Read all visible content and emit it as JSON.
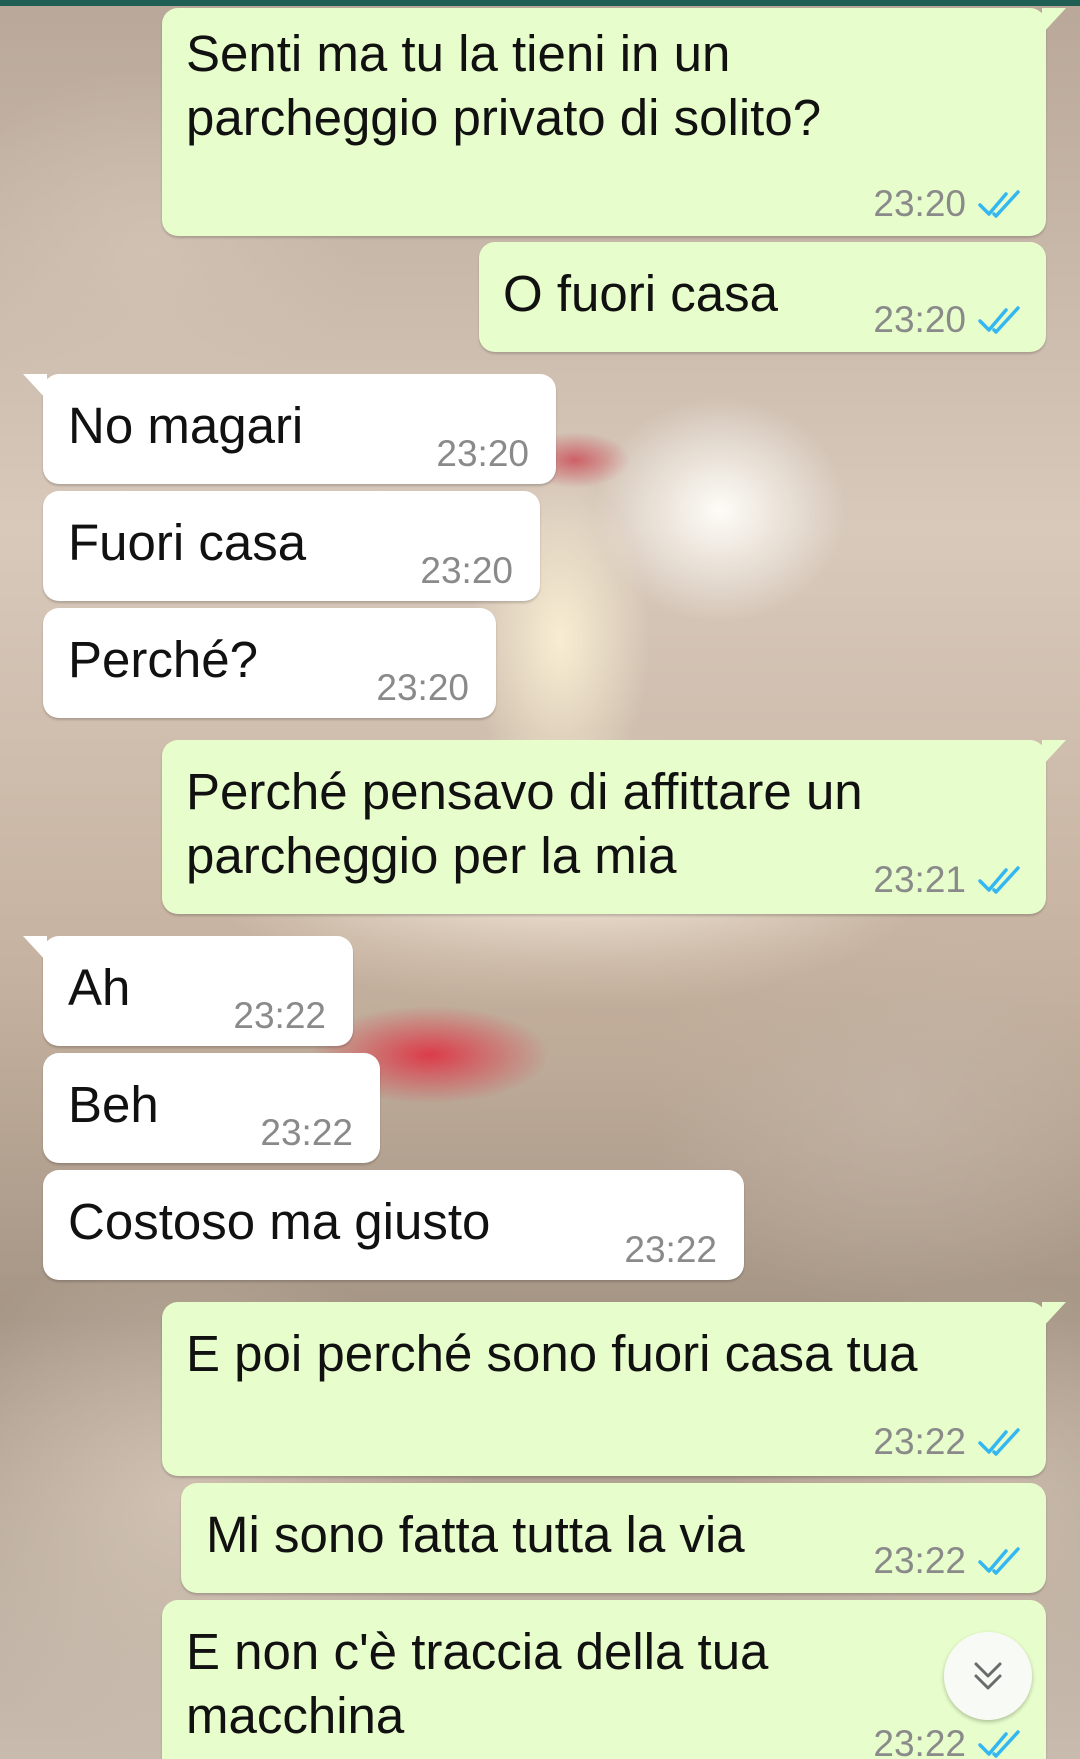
{
  "colors": {
    "outgoing_bubble": "#e7fdcb",
    "incoming_bubble": "#ffffff",
    "read_check": "#34b7f1",
    "timestamp": "#8a8a8a"
  },
  "messages": [
    {
      "direction": "out",
      "text": "Senti ma tu la tieni in un\nparcheggio privato di solito?",
      "time": "23:20",
      "status": "read"
    },
    {
      "direction": "out",
      "text": "O fuori casa",
      "time": "23:20",
      "status": "read"
    },
    {
      "direction": "in",
      "text": "No magari",
      "time": "23:20"
    },
    {
      "direction": "in",
      "text": "Fuori casa",
      "time": "23:20"
    },
    {
      "direction": "in",
      "text": "Perché?",
      "time": "23:20"
    },
    {
      "direction": "out",
      "text": "Perché pensavo di affittare un\nparcheggio per la mia",
      "time": "23:21",
      "status": "read"
    },
    {
      "direction": "in",
      "text": "Ah",
      "time": "23:22"
    },
    {
      "direction": "in",
      "text": "Beh",
      "time": "23:22"
    },
    {
      "direction": "in",
      "text": "Costoso ma giusto",
      "time": "23:22"
    },
    {
      "direction": "out",
      "text": "E poi perché sono fuori casa tua",
      "time": "23:22",
      "status": "read"
    },
    {
      "direction": "out",
      "text": "Mi sono fatta tutta la via",
      "time": "23:22",
      "status": "read"
    },
    {
      "direction": "out",
      "text": "E non c'è traccia della tua\nmacchina",
      "time": "23:22",
      "status": "read"
    }
  ],
  "scroll_down_icon": "chevron-double-down-icon"
}
